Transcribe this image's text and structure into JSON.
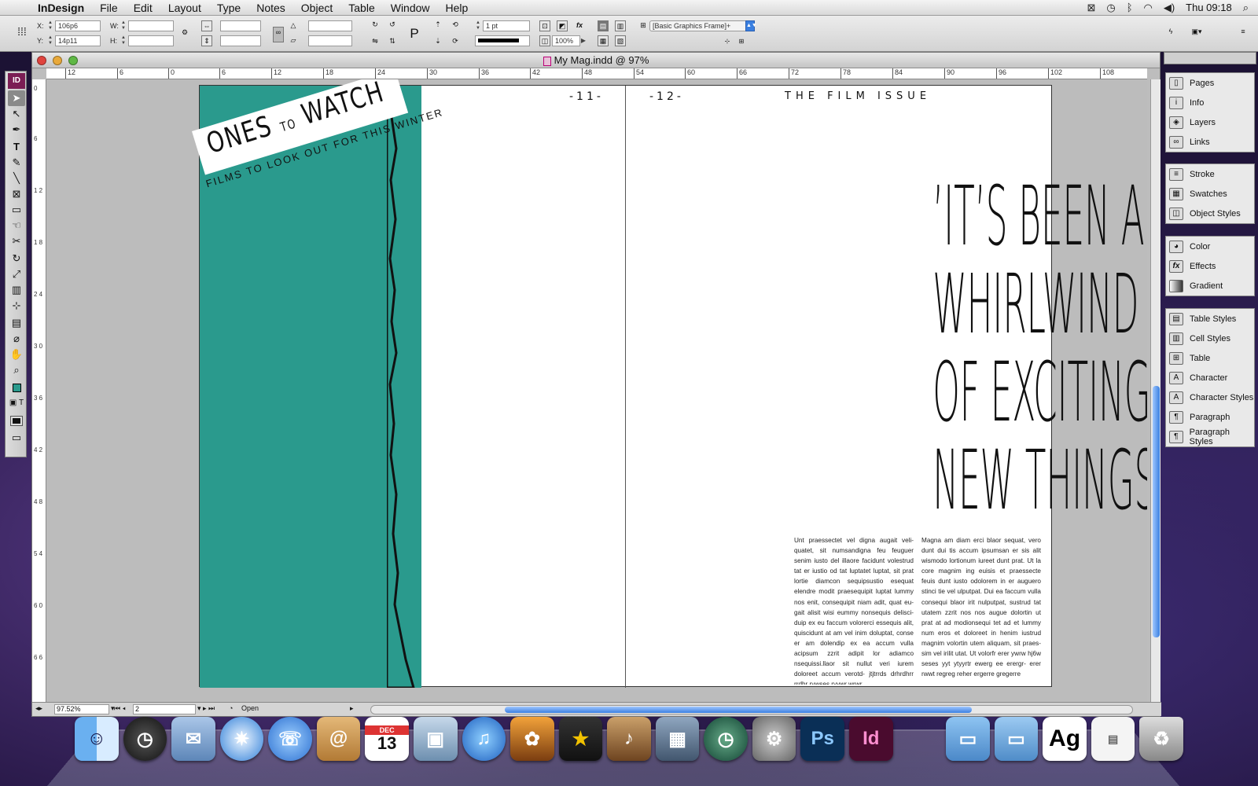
{
  "menubar": {
    "app": "InDesign",
    "items": [
      "File",
      "Edit",
      "Layout",
      "Type",
      "Notes",
      "Object",
      "Table",
      "Window",
      "Help"
    ],
    "clock": "Thu 09:18"
  },
  "control": {
    "x_label": "X:",
    "x_value": "106p6",
    "y_label": "Y:",
    "y_value": "14p11",
    "w_label": "W:",
    "h_label": "H:",
    "stroke_weight": "1 pt",
    "scale": "100%",
    "object_style": "[Basic Graphics Frame]+"
  },
  "window": {
    "title": "My Mag.indd @ 97%"
  },
  "ruler": {
    "h_labels": [
      "12",
      "6",
      "0",
      "6",
      "12",
      "18",
      "24",
      "30",
      "36",
      "42",
      "48",
      "54",
      "60",
      "66",
      "72",
      "78",
      "84",
      "90",
      "96",
      "102",
      "108"
    ],
    "v_labels": [
      "0",
      "6",
      "1 2",
      "1 8",
      "2 4",
      "3 0",
      "3 6",
      "4 2",
      "4 8",
      "5 4",
      "6 0",
      "6 6"
    ]
  },
  "document": {
    "left_page_no": "-11-",
    "right_page_no": "-12-",
    "running_head": "THE FILM ISSUE",
    "banner_title_a": "ONES",
    "banner_title_b": "TO",
    "banner_title_c": "WATCH",
    "banner_subtitle": "FILMS TO LOOK OUT FOR THIS WINTER",
    "quote_lines": [
      "’IT’S BEEN A",
      "WHIRLWIND",
      "OF EXCITING",
      "NEW THINGS’"
    ],
    "col1": "Unt praessectet vel digna augait veli- quatet, sit numsandigna feu feuguer senim iusto del illaore facidunt volestrud tat er iustio od tat luptatet luptat, sit prat lortie diamcon sequipsustio esequat elendre modit praesequipit luptat lummy nos enit, consequipit niam adit, quat eu- gait alisit wisi eummy nonsequis delisci- duip ex eu faccum volorerci essequis alit, quiscidunt at am vel inim doluptat, conse er am dolendip ex ea accum vulla acipsum zzrit adipit lor adiamco nsequissi.llaor sit nullut veri iurem doloreet accum verotd- jtjtrrds drhrdhrr rrdhr rywses ryywr wrwr",
    "col2": "Magna am diam erci blaor sequat, vero dunt dui tis accum ipsumsan er sis alit wismodo lortionum iureet dunt prat. Ut la core magnim ing euisis et praessecte feuis dunt iusto odolorem in er auguero stinci tie vel ulputpat. Dui ea faccum vulla consequi blaor irit nulputpat, sustrud tat utatem zzrit nos nos augue dolortin ut prat at ad modionsequi tet ad et lummy num eros et doloreet in henim iustrud magnim volortin utem aliquam, sit praes- sim vel irilit utat. Ut volorfr erer ywrw hj6w seses yyt ytyyrtr ewerg ee erergr- erer rwwt regreg reher ergerre gregerre"
  },
  "status": {
    "zoom": "97.52%",
    "page": "2",
    "state": "Open"
  },
  "panels": {
    "group1": [
      "Pages",
      "Info",
      "Layers",
      "Links"
    ],
    "group2": [
      "Stroke",
      "Swatches",
      "Object Styles"
    ],
    "group3": [
      "Color",
      "Effects",
      "Gradient"
    ],
    "group4": [
      "Table Styles",
      "Cell Styles",
      "Table",
      "Character",
      "Character Styles",
      "Paragraph",
      "Paragraph Styles"
    ]
  },
  "dock": {
    "calendar_month": "DEC",
    "calendar_day": "13",
    "ps": "Ps",
    "id": "Id",
    "ag": "Ag"
  },
  "colors": {
    "teal": "#2a9a8d",
    "accent": "#3a7fe0"
  }
}
